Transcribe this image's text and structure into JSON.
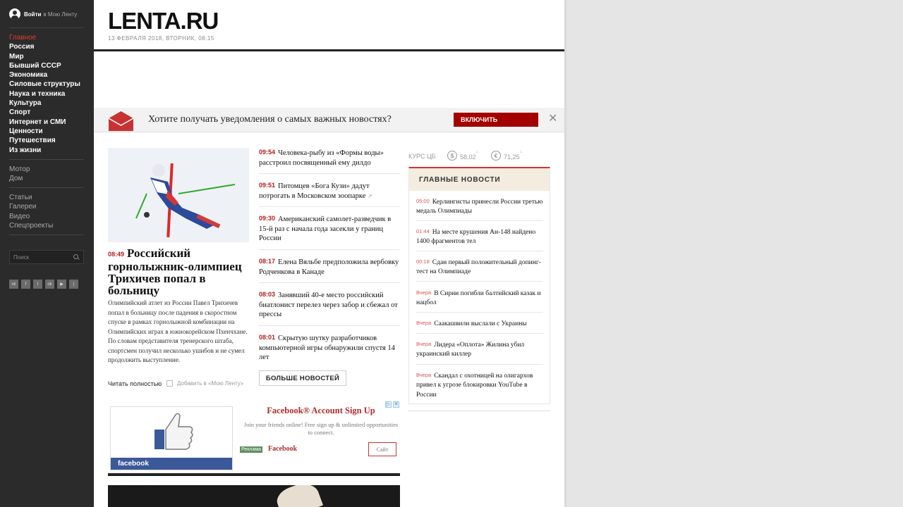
{
  "sidebar": {
    "login_bold": "Войти",
    "login_rest": "в Мою Ленту",
    "nav": [
      "Главное",
      "Россия",
      "Мир",
      "Бывший СССР",
      "Экономика",
      "Силовые структуры",
      "Наука и техника",
      "Культура",
      "Спорт",
      "Интернет и СМИ",
      "Ценности",
      "Путешествия",
      "Из жизни"
    ],
    "nav2": [
      "Мотор",
      "Дом"
    ],
    "nav3": [
      "Статьи",
      "Галереи",
      "Видео",
      "Спецпроекты"
    ],
    "search_placeholder": "Поиск",
    "social": [
      "vk",
      "f",
      "tw",
      "ok",
      "yt",
      "rss"
    ]
  },
  "header": {
    "logo": "LENTA.RU",
    "date": "13 ФЕВРАЛЯ 2018, ВТОРНИК, 08:15"
  },
  "notify": {
    "question": "Хотите получать уведомления о самых важных новостях?",
    "button": "ВКЛЮЧИТЬ"
  },
  "lead": {
    "time": "08:49",
    "title": "Российский горнолыжник-олимпиец Трихичев попал в больницу",
    "text": "Олимпийский атлет из России Павел Трихичев попал в больницу после падения в скоростном спуске в рамках горнолыжной комбинации на Олимпийских играх в южнокорейском Пхенчхане. По словам представителя тренерского штаба, спортсмен получил несколько ушибов и не сумел продолжить выступление.",
    "read_more": "Читать полностью",
    "add": "Добавить в «Мою Ленту»"
  },
  "news": [
    {
      "time": "09:54",
      "text": "Человека-рыбу из «Формы воды» расстроил посвященный ему дилдо"
    },
    {
      "time": "09:51",
      "text": "Питомцев «Бога Кузи» дадут потрогать в Московском зоопарке"
    },
    {
      "time": "09:30",
      "text": "Американский самолет-разведчик в 15-й раз с начала года засекли у границ России"
    },
    {
      "time": "08:17",
      "text": "Елена Вяльбе предположила вербовку Родченкова в Канаде"
    },
    {
      "time": "08:03",
      "text": "Занявший 40-е место российский биатлонист перелез через забор и сбежал от прессы"
    },
    {
      "time": "08:01",
      "text": "Скрытую шутку разработчиков компьютерной игры обнаружили спустя 14 лет"
    }
  ],
  "more_button": "БОЛЬШЕ НОВОСТЕЙ",
  "rates": {
    "label": "КУРС ЦБ",
    "usd_symbol": "$",
    "usd": "58,02",
    "eur_symbol": "€",
    "eur": "71,25",
    "usd_arrow": "↓",
    "eur_arrow": "↓"
  },
  "top_news": {
    "title": "ГЛАВНЫЕ НОВОСТИ",
    "items": [
      {
        "time": "05:00",
        "text": "Керлингисты принесли России третью медаль Олимпиады"
      },
      {
        "time": "01:44",
        "text": "На месте крушения Ан-148 найдено 1400 фрагментов тел"
      },
      {
        "time": "00:18",
        "text": "Сдан первый положительный допинг-тест на Олимпиаде"
      },
      {
        "time": "Вчера",
        "text": "В Сирии погибли балтийский казак и нацбол"
      },
      {
        "time": "Вчера",
        "text": "Саакашвили выслали с Украины"
      },
      {
        "time": "Вчера",
        "text": "Лидера «Оплота» Жилина убил украинский киллер"
      },
      {
        "time": "Вчера",
        "text": "Скандал с охотницей на олигархов привел к угрозе блокировки YouTube в России"
      }
    ]
  },
  "ad": {
    "title": "Facebook® Account Sign Up",
    "desc": "Join your friends online! Free sign up & unlimited opportunities to connect.",
    "badge": "Реклама",
    "brand": "Facebook",
    "button": "Сайт",
    "image_label": "facebook"
  },
  "colors": {
    "accent_red": "#a40000",
    "sidebar_bg": "#2b2b2b",
    "time_red": "#b01e1e"
  }
}
